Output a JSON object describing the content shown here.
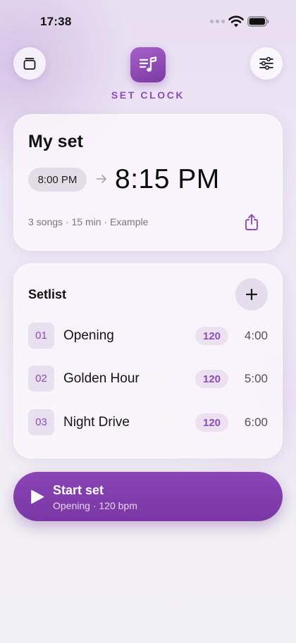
{
  "status_bar": {
    "time": "17:38"
  },
  "header": {
    "left_button_icon": "stack-icon",
    "logo_icon": "music-list-icon",
    "app_title": "SET CLOCK",
    "right_button_icon": "sliders-icon"
  },
  "set_card": {
    "name": "My set",
    "start_time": "8:00 PM",
    "end_time": "8:15 PM",
    "meta": "3 songs · 15 min · Example",
    "share_icon": "share-icon"
  },
  "setlist": {
    "title": "Setlist",
    "add_icon": "plus-icon",
    "songs": [
      {
        "number": "01",
        "title": "Opening",
        "bpm": "120",
        "duration": "4:00"
      },
      {
        "number": "02",
        "title": "Golden Hour",
        "bpm": "120",
        "duration": "5:00"
      },
      {
        "number": "03",
        "title": "Night Drive",
        "bpm": "120",
        "duration": "6:00"
      }
    ]
  },
  "start_button": {
    "label": "Start set",
    "subtitle": "Opening · 120 bpm",
    "icon": "play-icon"
  },
  "colors": {
    "accent": "#8a4db5",
    "button": "#7f3cab",
    "pill_bg": "#ebe1f1"
  }
}
